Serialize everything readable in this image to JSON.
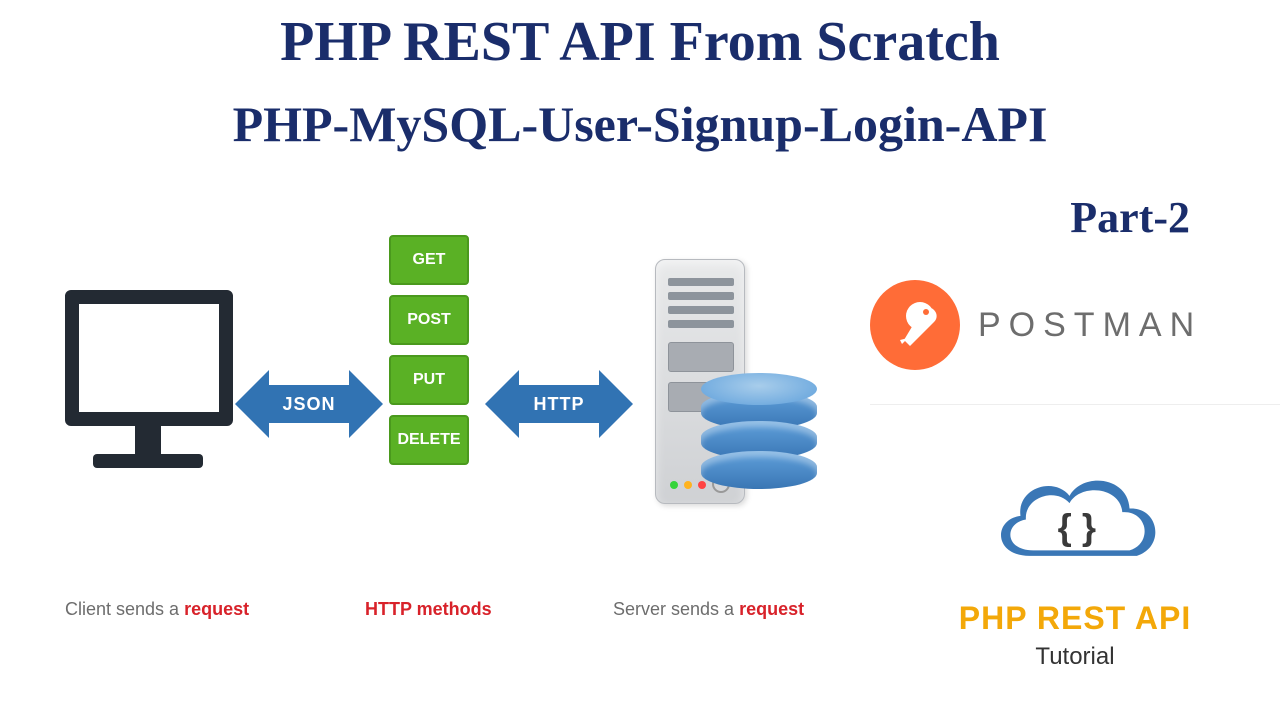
{
  "title_main": "PHP REST API From Scratch",
  "title_sub": "PHP-MySQL-User-Signup-Login-API",
  "title_part": "Part-2",
  "arrows": {
    "json": "JSON",
    "http": "HTTP"
  },
  "methods": [
    "GET",
    "POST",
    "PUT",
    "DELETE"
  ],
  "captions": {
    "client_prefix": "Client sends a ",
    "client_strong": "request",
    "http": "HTTP methods",
    "server_prefix": "Server sends a ",
    "server_strong": "request"
  },
  "postman_label": "POSTMAN",
  "rest_card": {
    "braces": "{ }",
    "title": "PHP REST API",
    "sub": "Tutorial"
  }
}
